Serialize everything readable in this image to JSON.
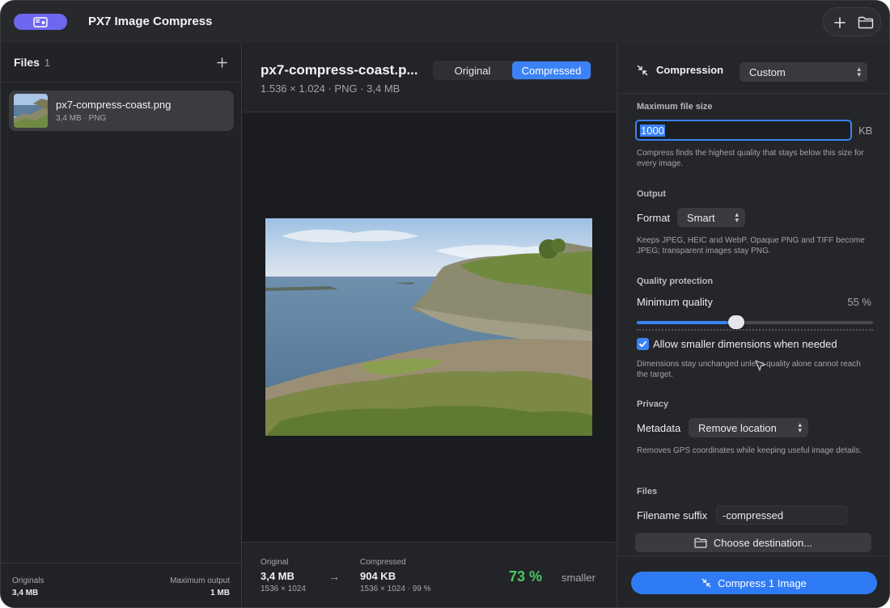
{
  "app": {
    "title": "PX7 Image Compress"
  },
  "icons": {
    "sidebar_toggle": "sidebar-icon",
    "add": "plus-icon",
    "open": "folder-icon",
    "compression": "compress-arrows-icon",
    "checkbox": "checkmark-icon"
  },
  "colors": {
    "accent": "#3b82f6",
    "toggle": "#6e67f0",
    "savings": "#4cc765"
  },
  "sidebar": {
    "title": "Files",
    "count": "1",
    "files": [
      {
        "name": "px7-compress-coast.png",
        "meta": "3,4 MB · PNG"
      }
    ],
    "footer": {
      "originals_label": "Originals",
      "originals_value": "3,4 MB",
      "max_output_label": "Maximum output",
      "max_output_value": "1 MB"
    }
  },
  "preview": {
    "title": "px7-compress-coast.p...",
    "subtitle": "1.536 × 1.024 · PNG · 3,4 MB",
    "tabs": [
      {
        "label": "Original",
        "active": false
      },
      {
        "label": "Compressed",
        "active": true
      }
    ],
    "stats": {
      "original_label": "Original",
      "original_size": "3,4 MB",
      "original_dims": "1536 × 1024",
      "arrow": "→",
      "compressed_label": "Compressed",
      "compressed_size": "904 KB",
      "compressed_dims": "1536 × 1024 · 99 %",
      "savings_pct": "73 %",
      "savings_label": "smaller"
    }
  },
  "settings": {
    "header": "Compression",
    "preset": "Custom",
    "max_file_size": {
      "title": "Maximum file size",
      "value": "1000",
      "unit": "KB",
      "help": "Compress finds the highest quality that stays below this size for every image."
    },
    "output": {
      "title": "Output",
      "format_label": "Format",
      "format_value": "Smart",
      "help": "Keeps JPEG, HEIC and WebP. Opaque PNG and TIFF become JPEG; transparent images stay PNG."
    },
    "quality": {
      "title": "Quality protection",
      "min_label": "Minimum quality",
      "min_value_text": "55 %",
      "min_value": 0.42,
      "allow_smaller_label": "Allow smaller dimensions when needed",
      "allow_smaller_checked": true,
      "help": "Dimensions stay unchanged unless quality alone cannot reach the target."
    },
    "privacy": {
      "title": "Privacy",
      "metadata_label": "Metadata",
      "metadata_value": "Remove location",
      "help": "Removes GPS coordinates while keeping useful image details."
    },
    "files": {
      "title": "Files",
      "suffix_label": "Filename suffix",
      "suffix_value": "-compressed",
      "destination_label": "Choose destination..."
    },
    "action_label": "Compress 1 Image"
  }
}
